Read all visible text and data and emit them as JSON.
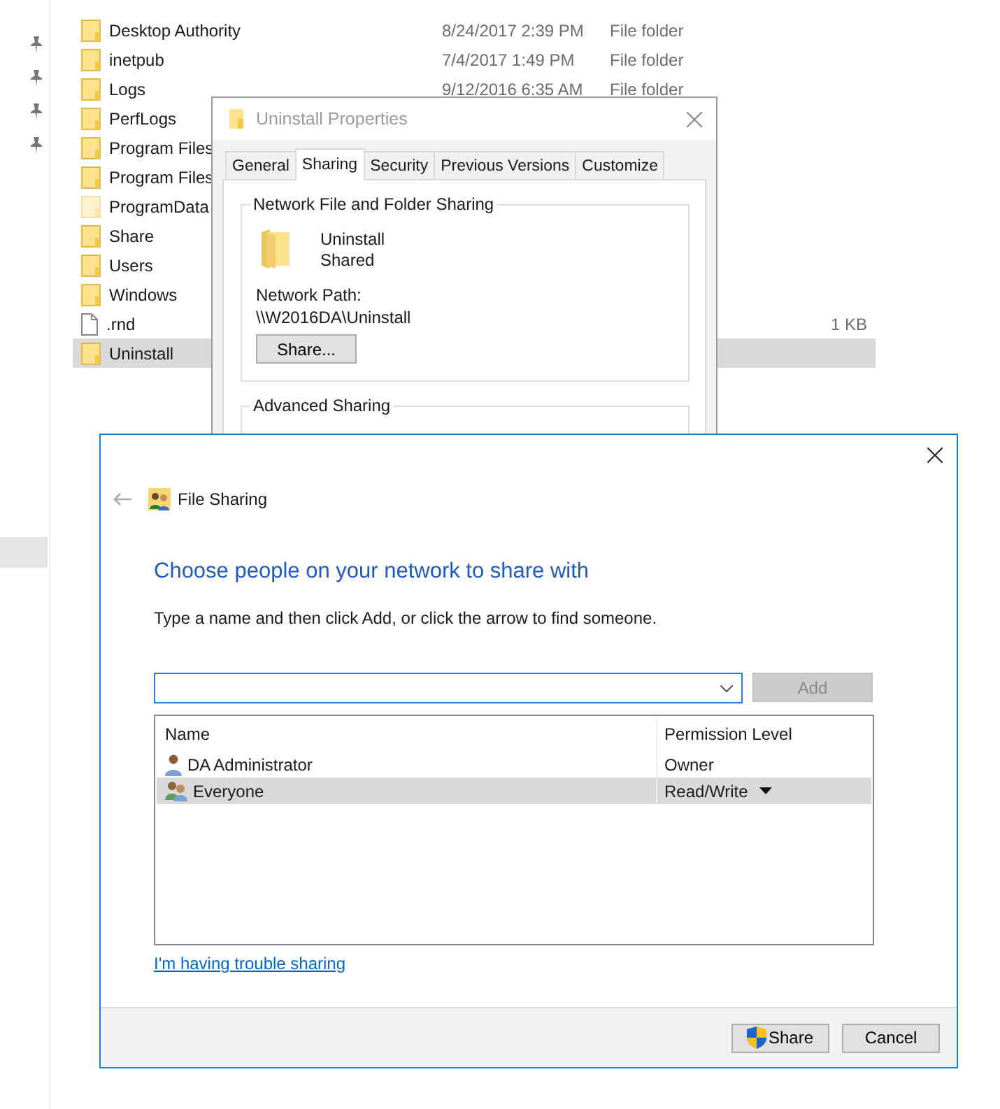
{
  "explorer": {
    "files": [
      {
        "name": "Desktop Authority",
        "date": "8/24/2017 2:39 PM",
        "type": "File folder",
        "kind": "folder",
        "selected": false
      },
      {
        "name": "inetpub",
        "date": "7/4/2017 1:49 PM",
        "type": "File folder",
        "kind": "folder",
        "selected": false
      },
      {
        "name": "Logs",
        "date": "9/12/2016 6:35 AM",
        "type": "File folder",
        "kind": "folder",
        "selected": false
      },
      {
        "name": "PerfLogs",
        "kind": "folder",
        "selected": false
      },
      {
        "name": "Program Files",
        "kind": "folder",
        "selected": false
      },
      {
        "name": "Program Files",
        "kind": "folder",
        "selected": false
      },
      {
        "name": "ProgramData",
        "kind": "hidden_folder",
        "selected": false
      },
      {
        "name": "Share",
        "kind": "folder",
        "selected": false
      },
      {
        "name": "Users",
        "kind": "folder",
        "selected": false
      },
      {
        "name": "Windows",
        "kind": "folder",
        "selected": false
      },
      {
        "name": ".rnd",
        "size": "1 KB",
        "kind": "file",
        "selected": false
      },
      {
        "name": "Uninstall",
        "kind": "folder",
        "selected": true
      }
    ]
  },
  "properties": {
    "title": "Uninstall Properties",
    "tabs": [
      {
        "label": "General",
        "selected": false
      },
      {
        "label": "Sharing",
        "selected": true
      },
      {
        "label": "Security",
        "selected": false
      },
      {
        "label": "Previous Versions",
        "selected": false
      },
      {
        "label": "Customize",
        "selected": false
      }
    ],
    "group_title": "Network File and Folder Sharing",
    "folder_name": "Uninstall",
    "share_status": "Shared",
    "network_path_label": "Network Path:",
    "network_path": "\\\\W2016DA\\Uninstall",
    "share_button": "Share...",
    "advanced_title": "Advanced Sharing"
  },
  "file_sharing": {
    "title": "File Sharing",
    "heading": "Choose people on your network to share with",
    "instruction": "Type a name and then click Add, or click the arrow to find someone.",
    "add_button": {
      "label": "Add",
      "disabled": true
    },
    "columns": [
      "Name",
      "Permission Level"
    ],
    "people": [
      {
        "name": "DA Administrator",
        "permission": "Owner",
        "kind": "user",
        "dropdown": false,
        "selected": false
      },
      {
        "name": "Everyone",
        "permission": "Read/Write",
        "kind": "group",
        "dropdown": true,
        "selected": true
      }
    ],
    "link": "I'm having trouble sharing",
    "buttons": [
      {
        "label": "Share",
        "kind": "shield"
      },
      {
        "label": "Cancel",
        "kind": "plain"
      }
    ]
  }
}
